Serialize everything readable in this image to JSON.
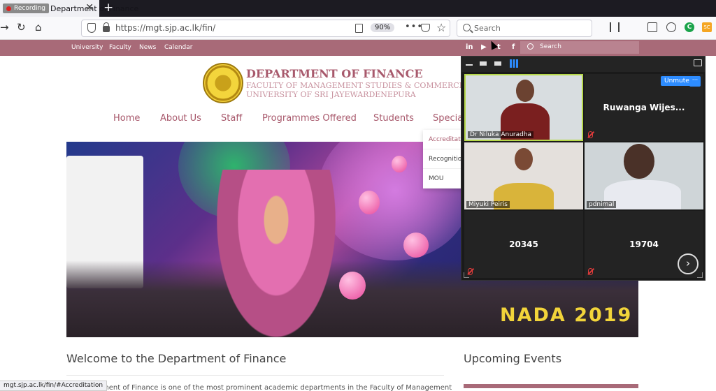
{
  "browser": {
    "tab_recording_label": "Recording",
    "tab_title": "Department of Finance",
    "url": "https://mgt.sjp.ac.lk/fin/",
    "zoom": "90%",
    "search_placeholder": "Search",
    "ext_green_label": "C",
    "ext_orange_label": "SC",
    "status_url": "mgt.sjp.ac.lk/fin/#Accreditation"
  },
  "site_topbar": {
    "links": [
      "University",
      "Faculty",
      "News",
      "Calendar"
    ],
    "social": [
      "in",
      "▶",
      "t",
      "f"
    ],
    "search_placeholder": "Search"
  },
  "header": {
    "title": "DEPARTMENT OF FINANCE",
    "faculty": "FACULTY OF MANAGEMENT STUDIES & COMMERCE",
    "university": "UNIVERSITY OF SRI JAYEWARDENEPURA"
  },
  "main_nav": [
    "Home",
    "About Us",
    "Staff",
    "Programmes Offered",
    "Students",
    "Specia"
  ],
  "dropdown": [
    "Accreditation",
    "Recognition",
    "MOU"
  ],
  "hero": {
    "banner_text": "NADA 2019"
  },
  "content": {
    "welcome_title": "Welcome to the Department of Finance",
    "intro_text": "rtment of Finance is one of the most prominent academic departments in the Faculty of Management",
    "upcoming_title": "Upcoming Events"
  },
  "meeting": {
    "unmute_label": "Unmute",
    "more_label": "···",
    "next_label": "›",
    "participants": [
      {
        "name": "Dr Niluka Anuradha",
        "video": true
      },
      {
        "name": "Ruwanga  Wijes...",
        "video": false
      },
      {
        "name": "Miyuki Peiris",
        "video": true
      },
      {
        "name": "pdnimal",
        "video": true
      },
      {
        "name": "20345",
        "video": false
      },
      {
        "name": "19704",
        "video": false
      }
    ]
  }
}
